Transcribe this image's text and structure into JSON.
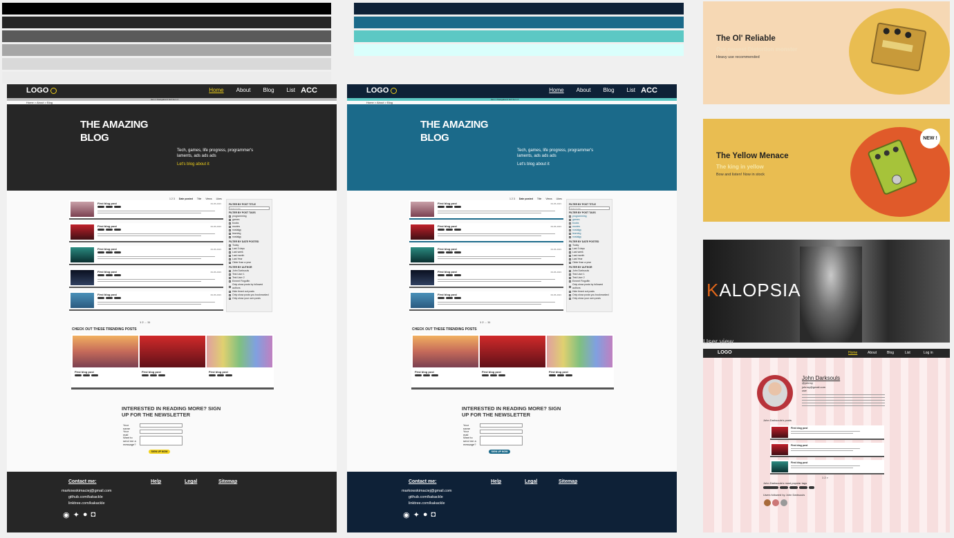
{
  "palette": {
    "grays": [
      "#000000",
      "#262626",
      "#5a5a5a",
      "#a6a6a6",
      "#d9d9d9",
      "#efefef"
    ],
    "teals": [
      "#0e2137",
      "#1b6a8a",
      "#5cc8c4",
      "#dafffc"
    ]
  },
  "mock_dark": {
    "colors": {
      "nav": "#262626",
      "hero": "#262626",
      "footer": "#262626",
      "accent": "#f2d21b"
    },
    "logo": "LOGO",
    "nav": [
      "Home",
      "About",
      "Blog",
      "List"
    ],
    "acc": "ACC",
    "subnav": "Item 1   Navigation2   Ite3   Item 4",
    "breadcrumb": "Home > About > Blog",
    "hero_title": "THE AMAZING BLOG",
    "hero_sub": "Tech, games, life progress, programmer's laments, ads ads ads",
    "hero_link": "Let's blog about it",
    "sortbar": [
      "1  2  3",
      "Date posted",
      "Title",
      "Views",
      "Likes"
    ],
    "posts": [
      "First blog post",
      "First blog post",
      "First blog post",
      "First blog post",
      "First blog post"
    ],
    "filter": {
      "title": "FILTER BY POST TITLE",
      "search": "Search title",
      "tags_h": "FILTER BY POST TAGS",
      "tags": [
        "programming",
        "games",
        "books",
        "movies",
        "nostalgy",
        "learning",
        "nostalgy"
      ],
      "date_h": "FILTER BY DATE POSTED",
      "dates": [
        "Today",
        "Last 3 days",
        "Last week",
        "Last month",
        "Last Year",
        "Older than a year"
      ],
      "author_h": "FILTER BY AUTHOR",
      "authors": [
        "John Darksouls",
        "Test User 1",
        "Test User 2",
        "Emmet Fingolfin"
      ],
      "opts": [
        "Only show posts by followed authors",
        "Hide timed out posts",
        "Only show posts you bookmarked",
        "Only show your own posts"
      ]
    },
    "pager": "1  2  ...  11",
    "trending_h": "CHECK OUT THESE TRENDING POSTS",
    "trending": [
      "First blog post",
      "First blog post",
      "First blog post"
    ],
    "trend_date": "09-05-2023",
    "news_title": "INTERESTED IN  READING MORE? SIGN UP FOR THE NEWSLETTER",
    "form_labels": [
      "Your name",
      "Your mail",
      "Want to send me a message?"
    ],
    "signup": "SIGN UP NOW",
    "footer": {
      "contact": "Contact me:",
      "links": [
        "Help",
        "Legal",
        "Sitemap"
      ],
      "info": [
        "markowskimaciej@gmail.com",
        "github.com/kakackle",
        "linktree.com/kakackle"
      ]
    }
  },
  "mock_teal": {
    "colors": {
      "nav": "#0e2137",
      "hero": "#1b6a8a",
      "footer": "#0e2137",
      "accent": "#1b6a8a"
    }
  },
  "promos": [
    {
      "title": "The Ol' Reliable",
      "sub": "Our newest Distortion monster",
      "desc": "Heavy use recommended",
      "bg": "#f6d8b4",
      "circle": "#e9bd51",
      "subcolor": "#f3e0c0"
    },
    {
      "title": "The Yellow Menace",
      "sub": "The king in yellow",
      "desc": "Bow and listen! Now in stock",
      "bg": "#e9bd51",
      "circle": "#e05a2a",
      "subcolor": "#f6e7a8",
      "badge": "NEW !"
    }
  ],
  "kalopsia": {
    "wordmark": "KALOPSIA"
  },
  "user_view_label": "User view",
  "profile": {
    "logo": "LOGO",
    "nav": [
      "Home",
      "About",
      "Blog",
      "List"
    ],
    "login": "Log in",
    "name": "John Darksouls",
    "handle": "@johnny",
    "email": "johnny@gmail.com",
    "role": "user",
    "posts_h": "John Darksouls's posts",
    "tags_h": "John Darksouls's most popular tags",
    "followed_h": "Users followed by John Darksouls",
    "pager": "1  2  >"
  }
}
